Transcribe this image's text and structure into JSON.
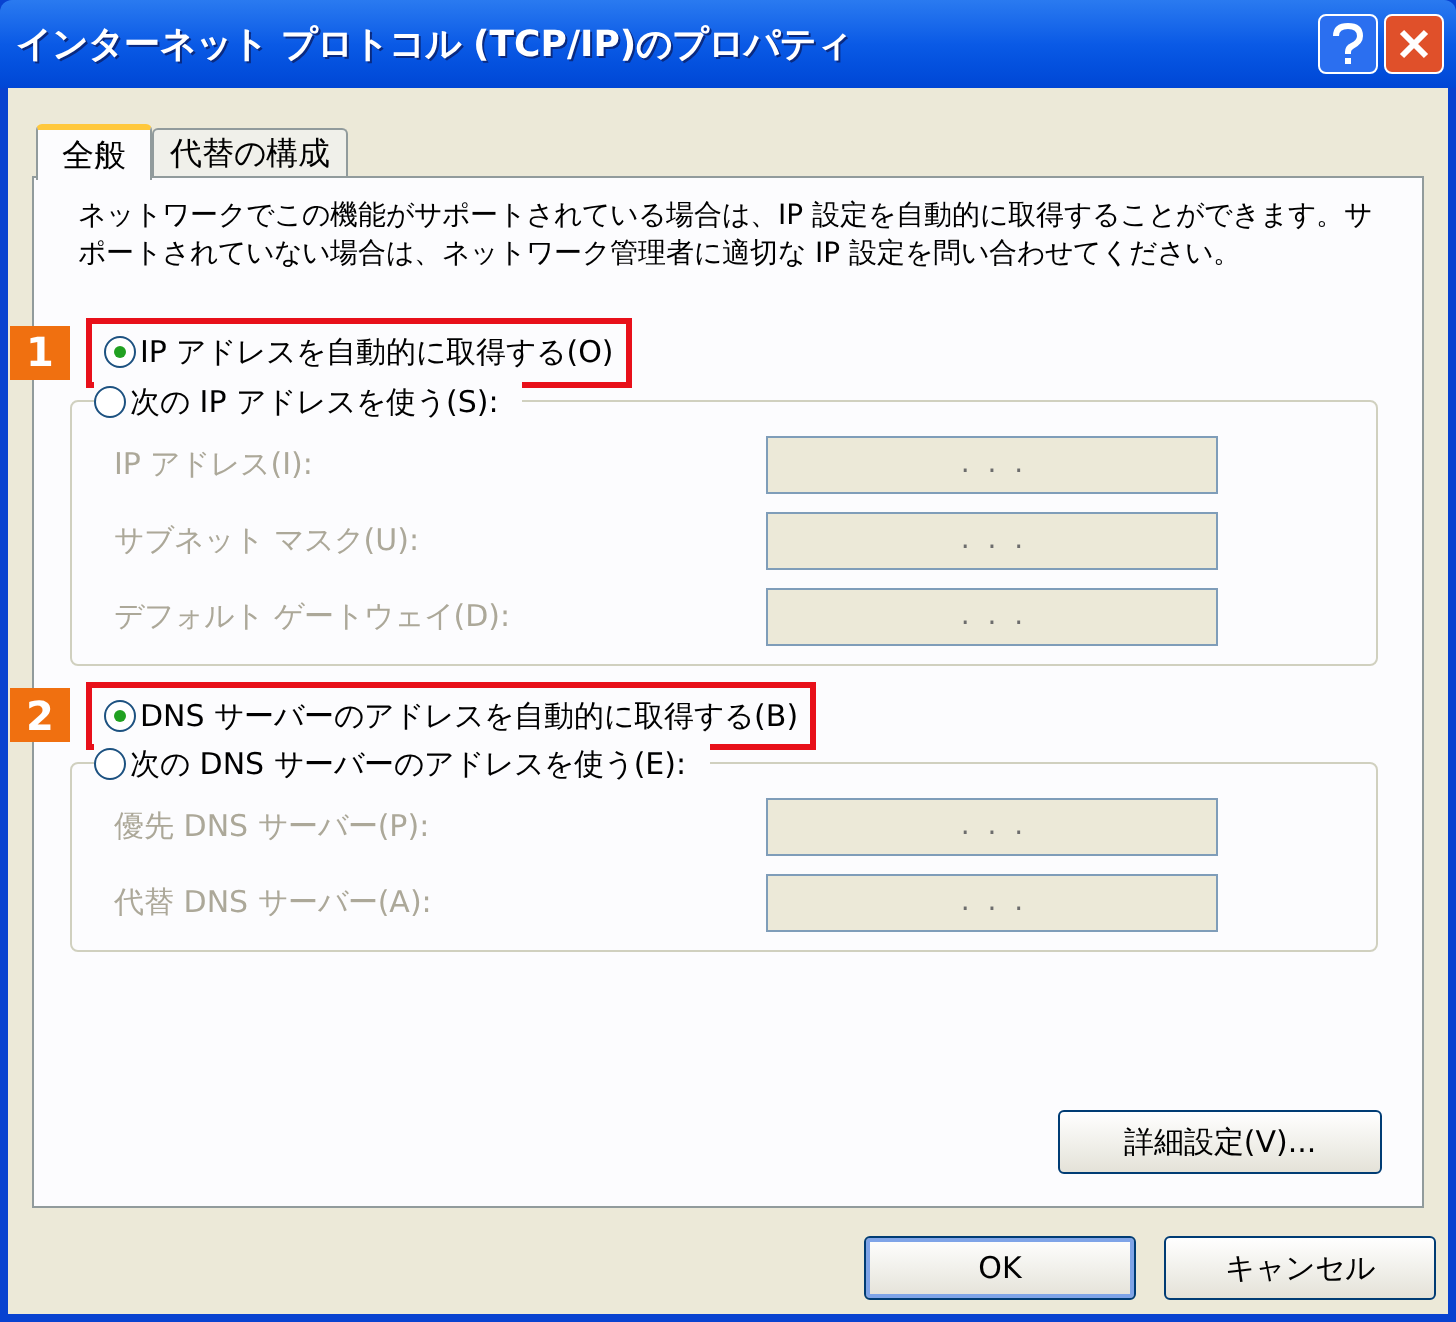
{
  "window": {
    "title": "インターネット プロトコル (TCP/IP)のプロパティ"
  },
  "tabs": [
    {
      "label": "全般",
      "selected": true
    },
    {
      "label": "代替の構成",
      "selected": false
    }
  ],
  "description": "ネットワークでこの機能がサポートされている場合は、IP 設定を自動的に取得することができます。サポートされていない場合は、ネットワーク管理者に適切な IP 設定を問い合わせてください。",
  "groups": [
    {
      "auto_option": {
        "marker": "1",
        "label": "IP アドレスを自動的に取得する(O)",
        "selected": true
      },
      "manual_option": {
        "label": "次の IP アドレスを使う(S):",
        "selected": false
      },
      "fields": [
        {
          "label": "IP アドレス(I):",
          "value": ".  .  .",
          "disabled": true
        },
        {
          "label": "サブネット マスク(U):",
          "value": ".  .  .",
          "disabled": true
        },
        {
          "label": "デフォルト ゲートウェイ(D):",
          "value": ".  .  .",
          "disabled": true
        }
      ]
    },
    {
      "auto_option": {
        "marker": "2",
        "label": "DNS サーバーのアドレスを自動的に取得する(B)",
        "selected": true
      },
      "manual_option": {
        "label": "次の DNS サーバーのアドレスを使う(E):",
        "selected": false
      },
      "fields": [
        {
          "label": "優先 DNS サーバー(P):",
          "value": ".  .  .",
          "disabled": true
        },
        {
          "label": "代替 DNS サーバー(A):",
          "value": ".  .  .",
          "disabled": true
        }
      ]
    }
  ],
  "advanced_button": "詳細設定(V)...",
  "buttons": [
    {
      "label": "OK",
      "default": true
    },
    {
      "label": "キャンセル",
      "default": false
    }
  ]
}
